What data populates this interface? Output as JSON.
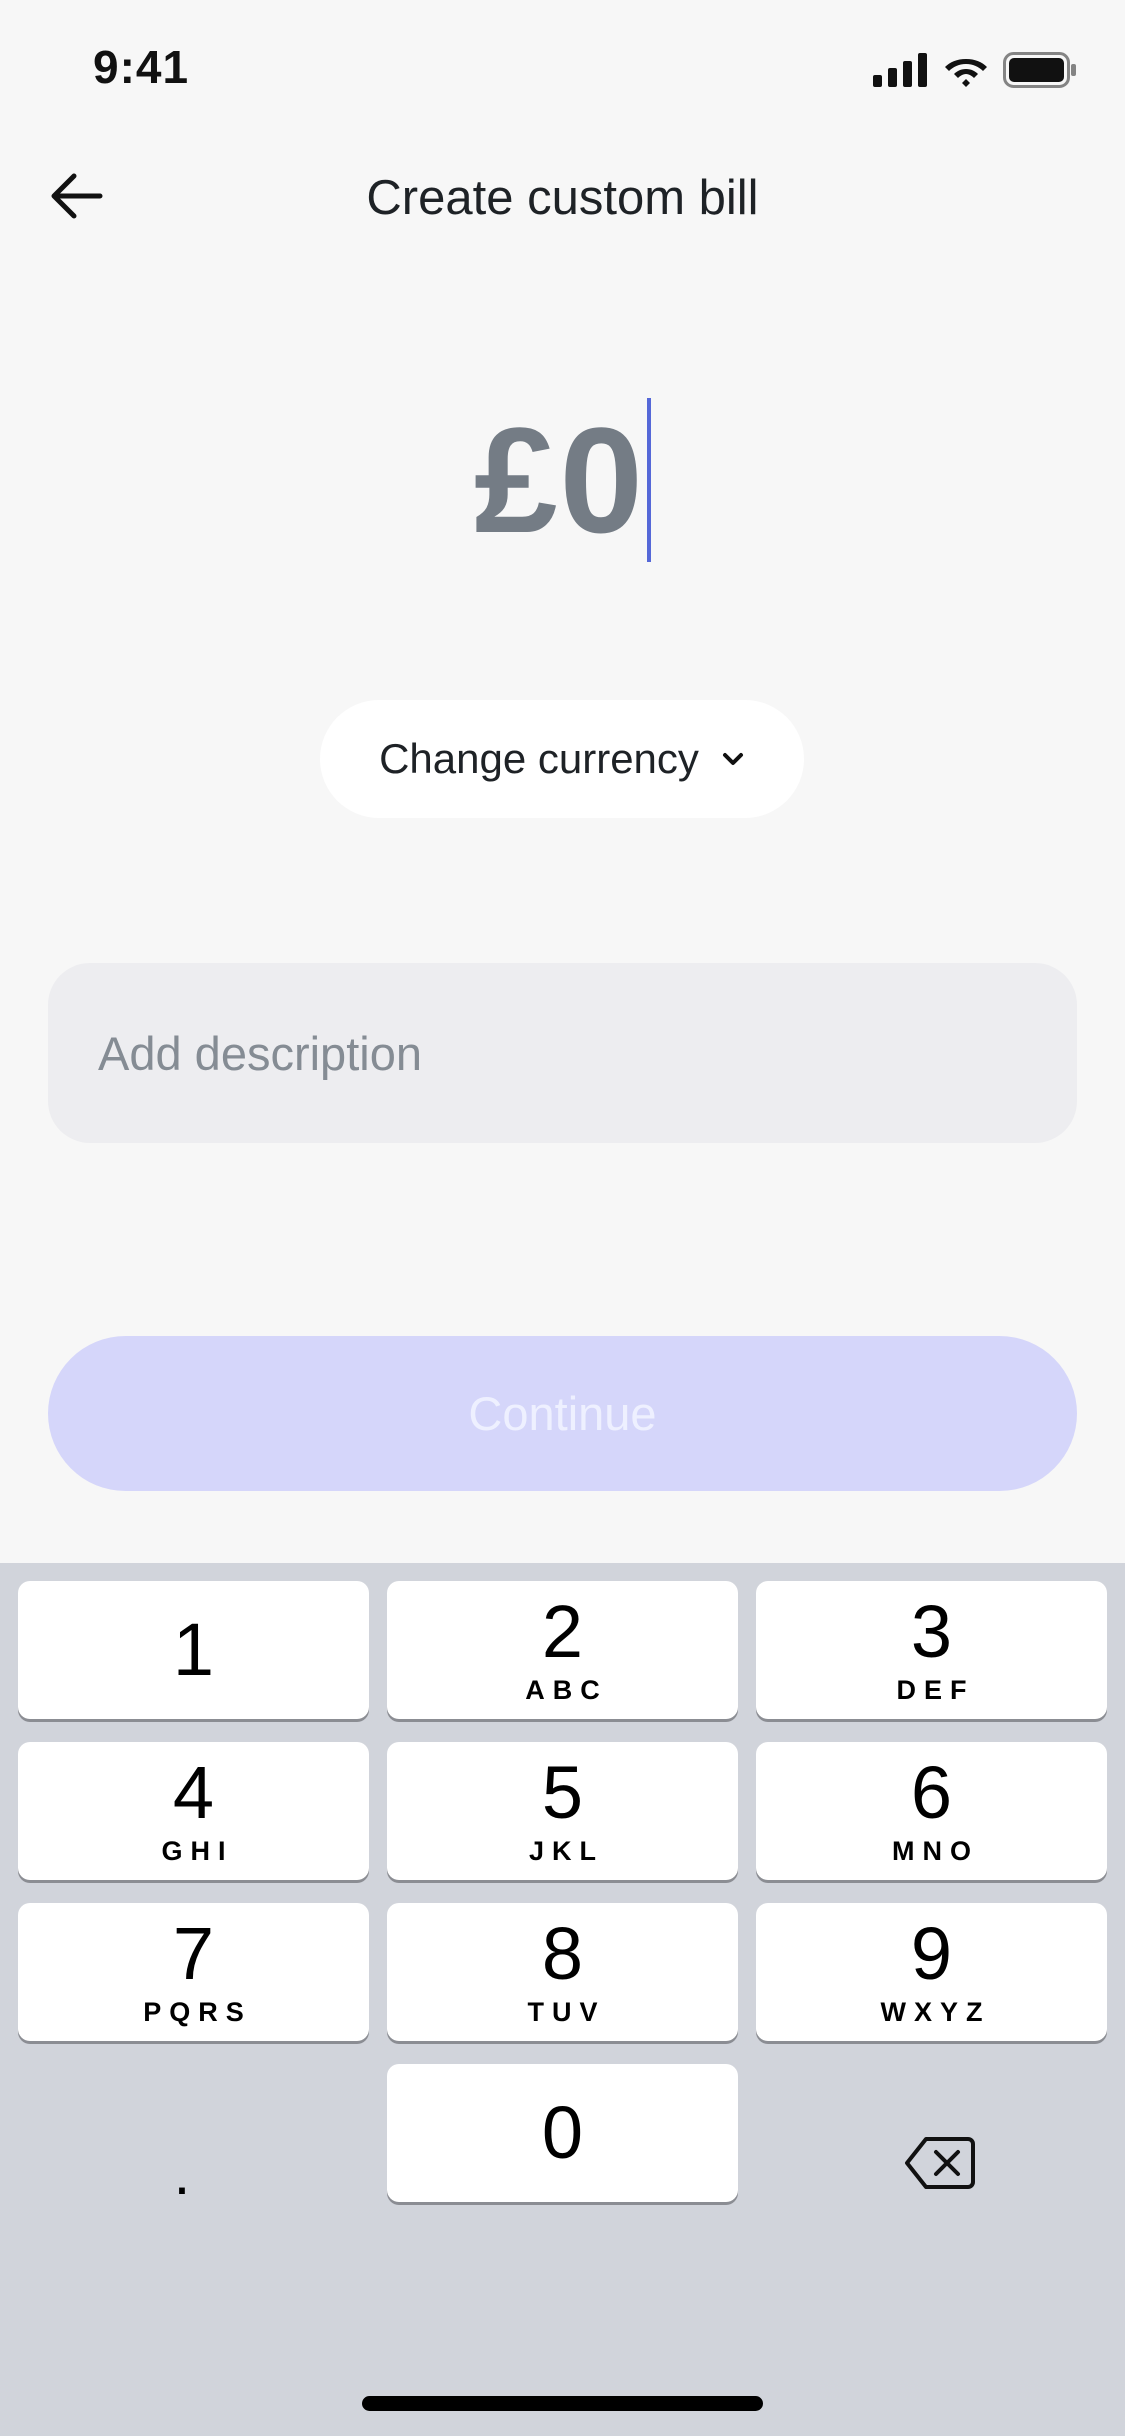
{
  "status_bar": {
    "time": "9:41"
  },
  "header": {
    "title": "Create custom bill"
  },
  "amount": {
    "value": "£0"
  },
  "currency_button": {
    "label": "Change currency"
  },
  "description": {
    "placeholder": "Add description",
    "value": ""
  },
  "continue_button": {
    "label": "Continue",
    "enabled": false
  },
  "keypad": {
    "keys": [
      {
        "num": "1",
        "letters": ""
      },
      {
        "num": "2",
        "letters": "ABC"
      },
      {
        "num": "3",
        "letters": "DEF"
      },
      {
        "num": "4",
        "letters": "GHI"
      },
      {
        "num": "5",
        "letters": "JKL"
      },
      {
        "num": "6",
        "letters": "MNO"
      },
      {
        "num": "7",
        "letters": "PQRS"
      },
      {
        "num": "8",
        "letters": "TUV"
      },
      {
        "num": "9",
        "letters": "WXYZ"
      },
      {
        "num": "0",
        "letters": ""
      }
    ],
    "decimal": "."
  },
  "colors": {
    "accent_caret": "#5568d8",
    "continue_disabled_bg": "#d5d6fa",
    "keyboard_bg": "#d1d4db"
  }
}
